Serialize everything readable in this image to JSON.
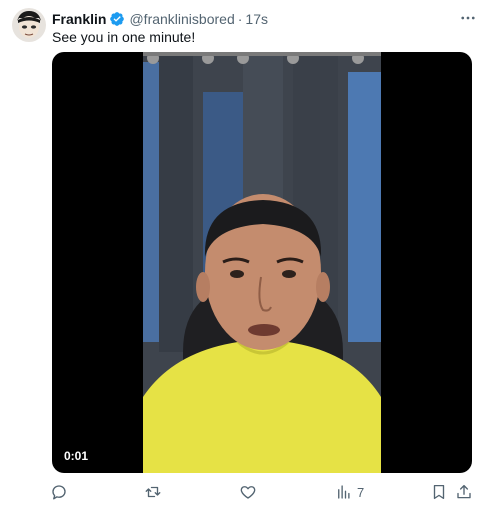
{
  "author": {
    "name": "Franklin",
    "handle": "@franklinisbored",
    "time": "17s",
    "separator": "·"
  },
  "tweet": {
    "text": "See you in one minute!"
  },
  "video": {
    "timestamp": "0:01"
  },
  "actions": {
    "views_count": "7"
  },
  "colors": {
    "verified": "#1d9bf0",
    "muted_text": "#536471",
    "shirt": "#e6e245"
  }
}
